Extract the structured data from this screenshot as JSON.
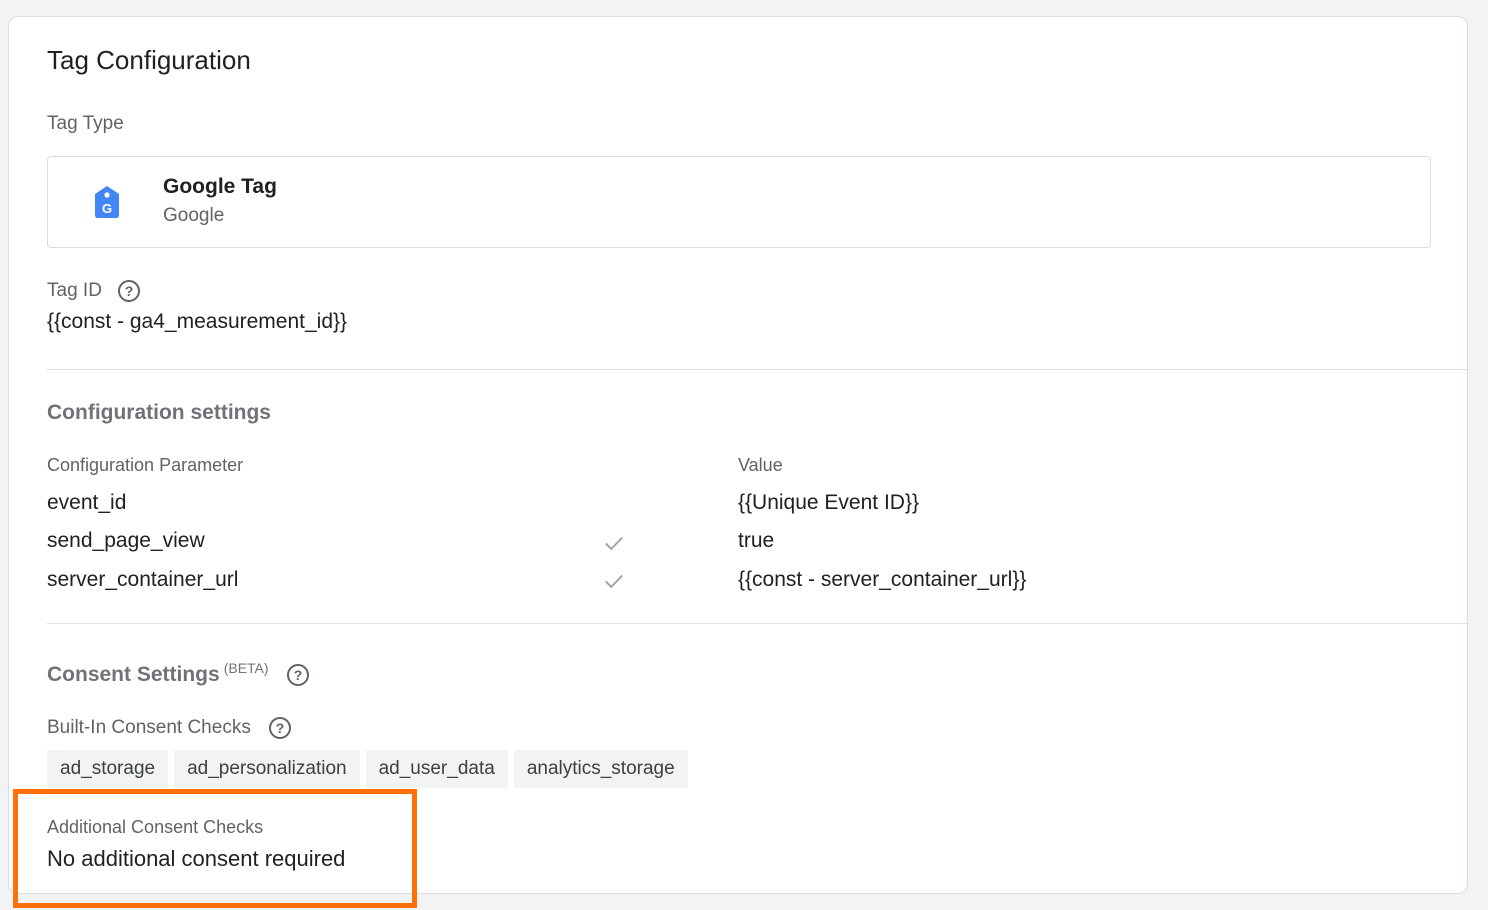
{
  "title": "Tag Configuration",
  "tag_type": {
    "label": "Tag Type",
    "name": "Google Tag",
    "vendor": "Google",
    "icon": "google-tag-icon",
    "icon_color": "#4285f4"
  },
  "tag_id": {
    "label": "Tag ID",
    "value": "{{const - ga4_measurement_id}}"
  },
  "configuration": {
    "title": "Configuration settings",
    "col_param": "Configuration Parameter",
    "col_value": "Value",
    "rows": [
      {
        "param": "event_id",
        "checked": false,
        "value": "{{Unique Event ID}}"
      },
      {
        "param": "send_page_view",
        "checked": true,
        "value": "true"
      },
      {
        "param": "server_container_url",
        "checked": true,
        "value": "{{const - server_container_url}}"
      }
    ]
  },
  "consent": {
    "title": "Consent Settings",
    "beta": "(BETA)",
    "builtin_label": "Built-In Consent Checks",
    "chips": [
      "ad_storage",
      "ad_personalization",
      "ad_user_data",
      "analytics_storage"
    ],
    "additional_label": "Additional Consent Checks",
    "additional_value": "No additional consent required"
  },
  "highlight_color": "#ff7107"
}
